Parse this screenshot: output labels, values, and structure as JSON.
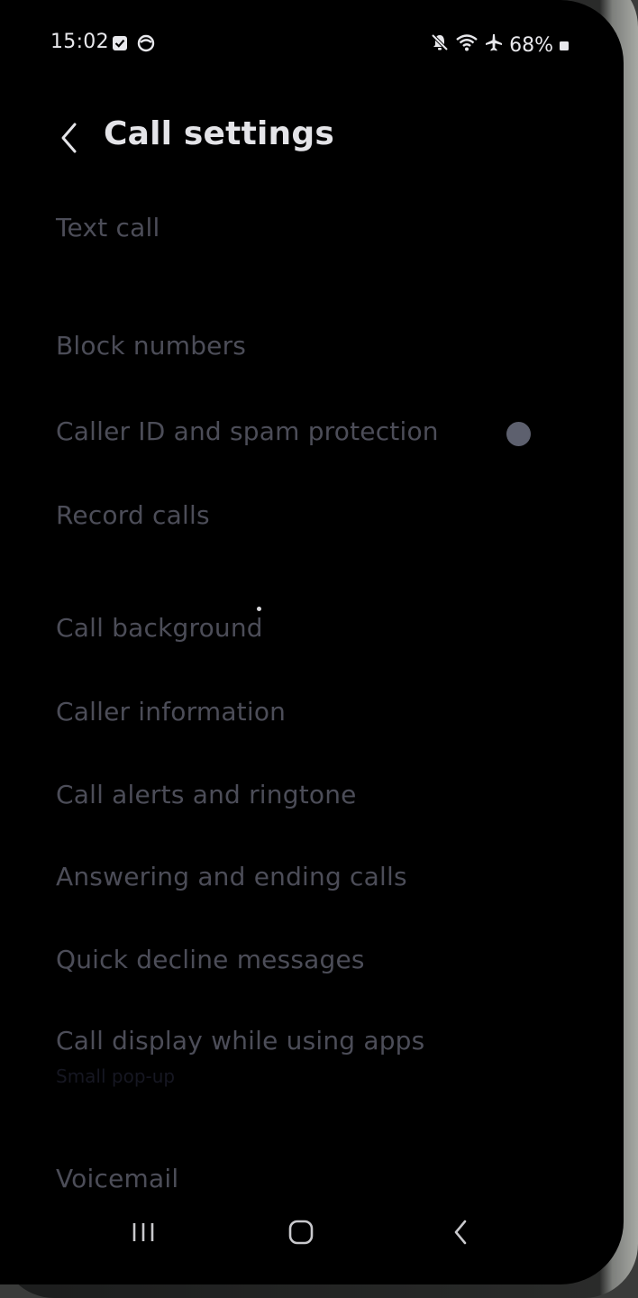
{
  "status_bar": {
    "time": "15:02",
    "left_icons": [
      "checkbox-notification-icon",
      "circle-notification-icon"
    ],
    "right_icons": [
      "mute-icon",
      "wifi-icon",
      "airplane-icon"
    ],
    "battery": "68%"
  },
  "header": {
    "title": "Call settings",
    "back_icon": "chevron-left-icon"
  },
  "menu": {
    "items": [
      {
        "label": "Text call"
      },
      {
        "label": "Block numbers"
      },
      {
        "label": "Caller ID and spam protection",
        "toggle": "on"
      },
      {
        "label": "Record calls"
      },
      {
        "label": "Call background"
      },
      {
        "label": "Caller information"
      },
      {
        "label": "Call alerts and ringtone"
      },
      {
        "label": "Answering and ending calls"
      },
      {
        "label": "Quick decline messages"
      },
      {
        "label": "Call display while using apps",
        "sublabel": "Small pop-up"
      },
      {
        "label": "Voicemail"
      }
    ]
  },
  "nav_bar": {
    "icons": [
      "recent-apps-icon",
      "home-icon",
      "back-icon"
    ]
  },
  "colors": {
    "background": "#000000",
    "title_text": "#e4e4e8",
    "item_text": "#4c4d58",
    "toggle": "#5d606e"
  }
}
